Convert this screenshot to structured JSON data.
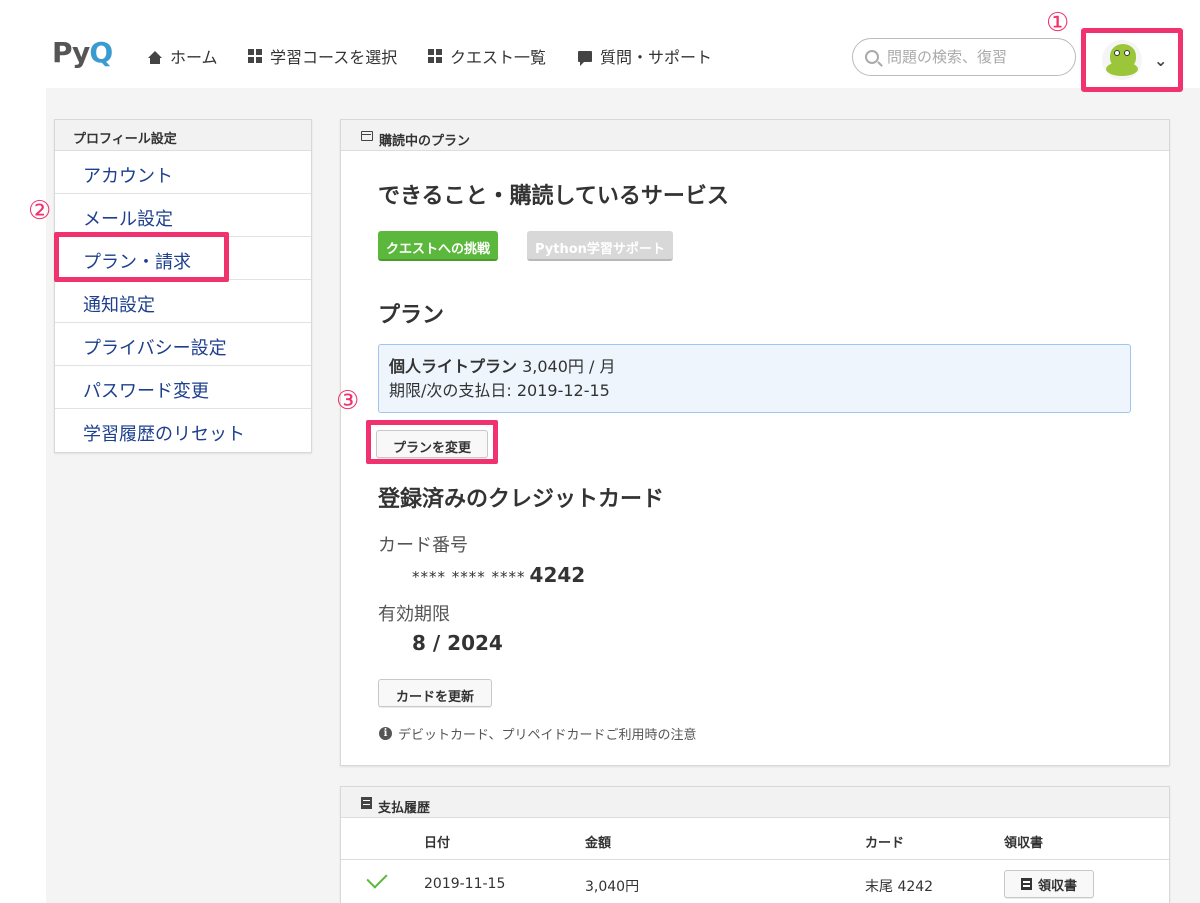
{
  "header": {
    "logo": {
      "p": "P",
      "y": "y",
      "q": "Q"
    },
    "nav": [
      {
        "label": "ホーム",
        "icon": "home-icon"
      },
      {
        "label": "学習コースを選択",
        "icon": "grid-icon"
      },
      {
        "label": "クエスト一覧",
        "icon": "grid-icon"
      },
      {
        "label": "質問・サポート",
        "icon": "chat-icon"
      }
    ],
    "search_placeholder": "問題の検索、復習"
  },
  "markers": {
    "m1": "①",
    "m2": "②",
    "m3": "③"
  },
  "sidebar": {
    "heading": "プロフィール設定",
    "items": [
      {
        "label": "アカウント"
      },
      {
        "label": "メール設定"
      },
      {
        "label": "プラン・請求"
      },
      {
        "label": "通知設定"
      },
      {
        "label": "プライバシー設定"
      },
      {
        "label": "パスワード変更"
      },
      {
        "label": "学習履歴のリセット"
      }
    ]
  },
  "subscription": {
    "card_title": "購読中のプラン",
    "services_heading": "できること・購読しているサービス",
    "badges": [
      {
        "label": "クエストへの挑戦",
        "color": "#5cb83c"
      },
      {
        "label": "Python学習サポート",
        "color": "#d8d8d8"
      }
    ],
    "plan_heading": "プラン",
    "plan_name": "個人ライトプラン",
    "plan_price": " 3,040円 / 月",
    "plan_period": "期限/次の支払日: 2019-12-15",
    "change_plan_button": "プランを変更",
    "card_heading": "登録済みのクレジットカード",
    "card_number_label": "カード番号",
    "card_number_mask": "**** **** ****",
    "card_number_last4": "4242",
    "expiry_label": "有効期限",
    "expiry_value": "8 / 2024",
    "update_card_button": "カードを更新",
    "notice": "デビットカード、プリペイドカードご利用時の注意"
  },
  "history": {
    "card_title": "支払履歴",
    "columns": [
      "日付",
      "金額",
      "カード",
      "領収書"
    ],
    "rows": [
      {
        "date": "2019-11-15",
        "amount": "3,040円",
        "card": "末尾 4242",
        "receipt": "領収書"
      }
    ]
  },
  "colors": {
    "highlight": "#f0326e",
    "link": "#1d3f8e",
    "badge_green": "#5cb83c"
  }
}
